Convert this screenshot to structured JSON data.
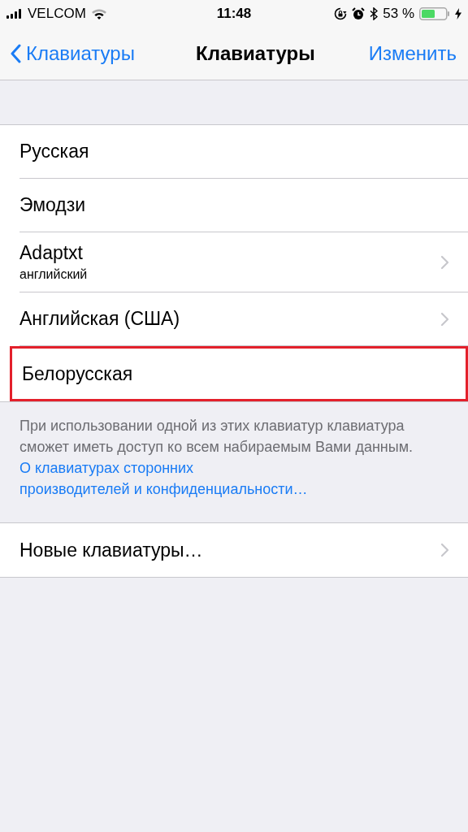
{
  "status_bar": {
    "carrier": "VELCOM",
    "time": "11:48",
    "battery": "53 %"
  },
  "nav": {
    "back": "Клавиатуры",
    "title": "Клавиатуры",
    "action": "Изменить"
  },
  "keyboards": [
    {
      "label": "Русская",
      "chevron": false,
      "highlighted": false
    },
    {
      "label": "Эмодзи",
      "chevron": false,
      "highlighted": false
    },
    {
      "label": "Adaptxt",
      "subtitle": "английский",
      "chevron": true,
      "highlighted": false
    },
    {
      "label": "Английская (США)",
      "chevron": true,
      "highlighted": false
    },
    {
      "label": "Белорусская",
      "chevron": false,
      "highlighted": true
    }
  ],
  "footer": {
    "text": "При использовании одной из этих клавиатур клавиатура сможет иметь доступ ко всем набираемым Вами данным.",
    "link_lines": [
      "О клавиатурах сторонних",
      "производителей и конфиденциальности…"
    ]
  },
  "add_row": {
    "label": "Новые клавиатуры…",
    "chevron": true
  }
}
